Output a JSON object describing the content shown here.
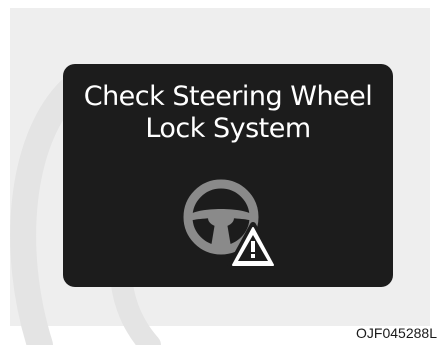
{
  "display": {
    "message_line1": "Check Steering Wheel",
    "message_line2": "Lock System",
    "icon": "steering-wheel-warning-icon"
  },
  "figure_code": "OJF045288L",
  "colors": {
    "screen_background": "#1c1c1c",
    "text": "#ffffff",
    "icon": "#8a8a8a",
    "page_frame": "#eeeeee"
  }
}
